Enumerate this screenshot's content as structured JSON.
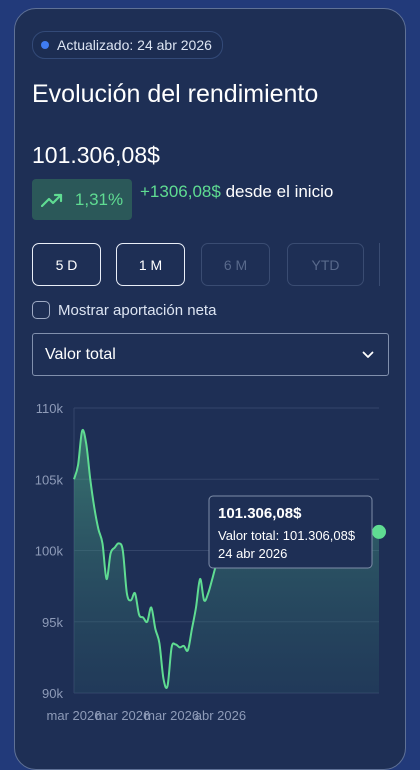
{
  "header": {
    "updated_label": "Actualizado: 24 abr 2026",
    "title": "Evolución del rendimiento",
    "total_value": "101.306,08$",
    "change_percent": "1,31%",
    "change_amount": "+1306,08$",
    "change_suffix": " desde el inicio"
  },
  "ranges": [
    {
      "label": "5 D",
      "state": "active"
    },
    {
      "label": "1 M",
      "state": "active"
    },
    {
      "label": "6 M",
      "state": "disabled"
    },
    {
      "label": "YTD",
      "state": "disabled"
    }
  ],
  "checkbox": {
    "label": "Mostrar aportación neta",
    "checked": false
  },
  "select": {
    "value": "Valor total"
  },
  "colors": {
    "accent": "#5fdc92",
    "card": "#1e2f55",
    "background": "#223a7a"
  },
  "tooltip": {
    "value": "101.306,08$",
    "line1": "Valor total: 101.306,08$",
    "line2": "24 abr 2026"
  },
  "chart_data": {
    "type": "area",
    "series": [
      {
        "name": "Valor total",
        "x": [
          0,
          1,
          2,
          3,
          4,
          5,
          6,
          7,
          8,
          9,
          10,
          11,
          12,
          13,
          14,
          15,
          16,
          17,
          18,
          19,
          20,
          21,
          22,
          23,
          24,
          25,
          26,
          27,
          28,
          29,
          30,
          31,
          32,
          33,
          34,
          35,
          36,
          37,
          38,
          39,
          40,
          41,
          42,
          43,
          44,
          45,
          46,
          47,
          48,
          49,
          50,
          51,
          52,
          53,
          54,
          55,
          56,
          57,
          58,
          59,
          60,
          61,
          62,
          63,
          64,
          65,
          66,
          67,
          68,
          69,
          70,
          71,
          72,
          73,
          74,
          75
        ],
        "values": [
          105.0,
          106.0,
          108.4,
          107.5,
          105.0,
          103.0,
          101.5,
          100.5,
          98.0,
          99.8,
          100.2,
          100.5,
          100.0,
          97.0,
          96.5,
          97.0,
          95.5,
          95.3,
          95.0,
          96.0,
          94.5,
          93.5,
          91.0,
          90.5,
          93.2,
          93.4,
          93.2,
          93.3,
          93.0,
          94.5,
          96.0,
          98.0,
          96.5,
          97.0,
          98.0,
          99.0,
          99.3,
          99.5,
          99.8,
          100.0,
          100.2,
          100.5,
          100.8,
          100.7,
          100.8,
          100.9,
          101.0,
          101.1,
          101.0,
          101.2,
          101.1,
          101.2,
          101.2,
          101.1,
          101.2,
          101.3,
          101.2,
          101.3,
          101.2,
          101.3,
          101.2,
          101.3,
          101.3,
          101.2,
          101.3,
          101.3,
          101.2,
          101.3,
          101.3,
          101.3,
          101.2,
          101.3,
          101.3,
          101.3,
          101.3,
          101.306
        ]
      }
    ],
    "yticks": [
      "110k",
      "105k",
      "100k",
      "95k",
      "90k"
    ],
    "ytick_values": [
      110,
      105,
      100,
      95,
      90
    ],
    "xticks": [
      "mar 2026",
      "mar 2026",
      "mar 2026",
      "abr 2026"
    ],
    "xtick_positions": [
      0,
      12,
      24,
      36
    ],
    "ylim": [
      90,
      110
    ],
    "xlabel": "",
    "ylabel": "",
    "grid": "horizontal"
  }
}
